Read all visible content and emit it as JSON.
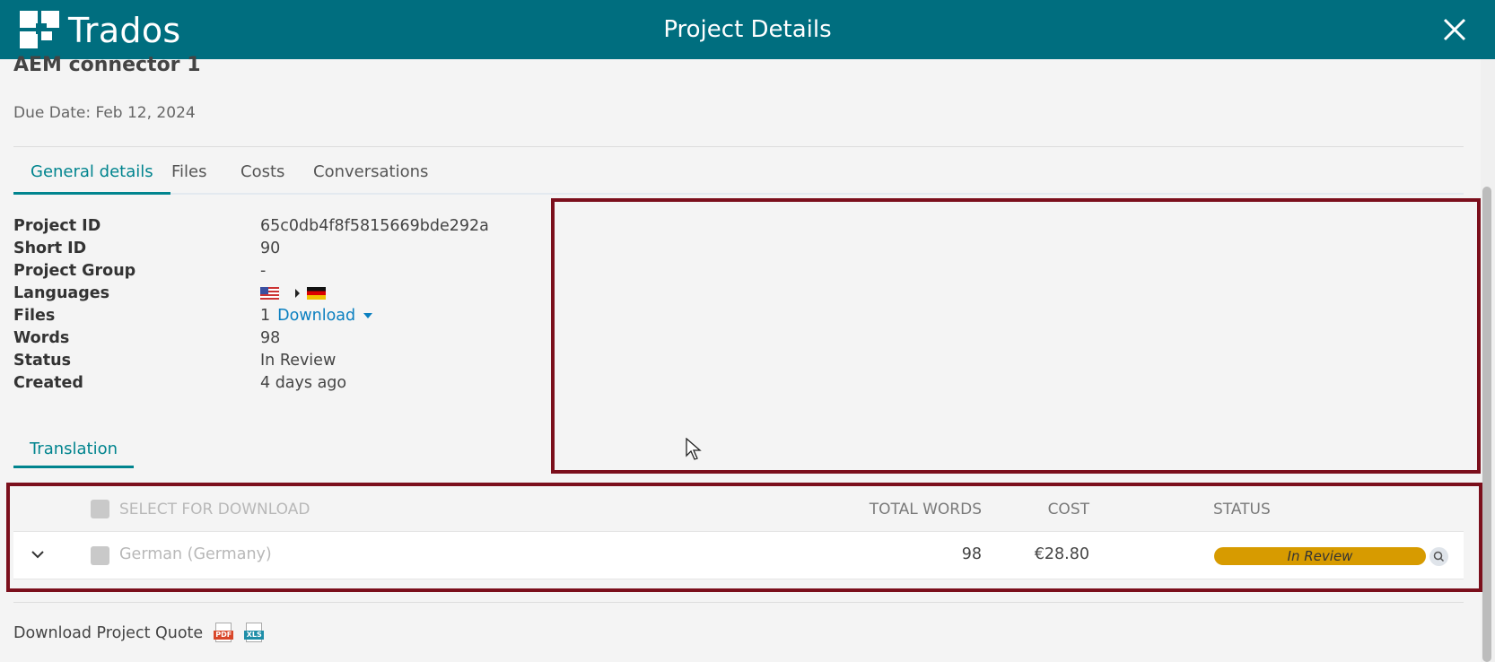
{
  "app": {
    "brand": "Trados",
    "window_title": "Project Details",
    "header_color": "#006e7f"
  },
  "project": {
    "title": "AEM connector 1",
    "due_date": "Due Date: Feb 12, 2024"
  },
  "tabs": [
    {
      "label": "General details",
      "active": true
    },
    {
      "label": "Files",
      "active": false
    },
    {
      "label": "Costs",
      "active": false
    },
    {
      "label": "Conversations",
      "active": false
    }
  ],
  "details": {
    "project_id": {
      "label": "Project ID",
      "value": "65c0db4f8f5815669bde292a"
    },
    "short_id": {
      "label": "Short ID",
      "value": "90"
    },
    "project_group": {
      "label": "Project Group",
      "value": "-"
    },
    "languages": {
      "label": "Languages",
      "source_flag": "us-flag-icon",
      "target_flag": "de-flag-icon"
    },
    "files": {
      "label": "Files",
      "count": "1",
      "download_label": "Download"
    },
    "words": {
      "label": "Words",
      "value": "98"
    },
    "status": {
      "label": "Status",
      "value": "In Review"
    },
    "created": {
      "label": "Created",
      "value": "4 days ago"
    }
  },
  "subtab": {
    "label": "Translation"
  },
  "table": {
    "headers": {
      "select": "SELECT FOR DOWNLOAD",
      "total_words": "TOTAL WORDS",
      "cost": "COST",
      "status": "STATUS"
    },
    "rows": [
      {
        "language": "German (Germany)",
        "words": "98",
        "cost": "€28.80",
        "status": "In Review",
        "status_color": "#d79b00"
      }
    ]
  },
  "footer": {
    "quote_label": "Download Project Quote",
    "pdf_label": "PDF",
    "xls_label": "XLS"
  },
  "highlight_color": "#7b0f1c"
}
